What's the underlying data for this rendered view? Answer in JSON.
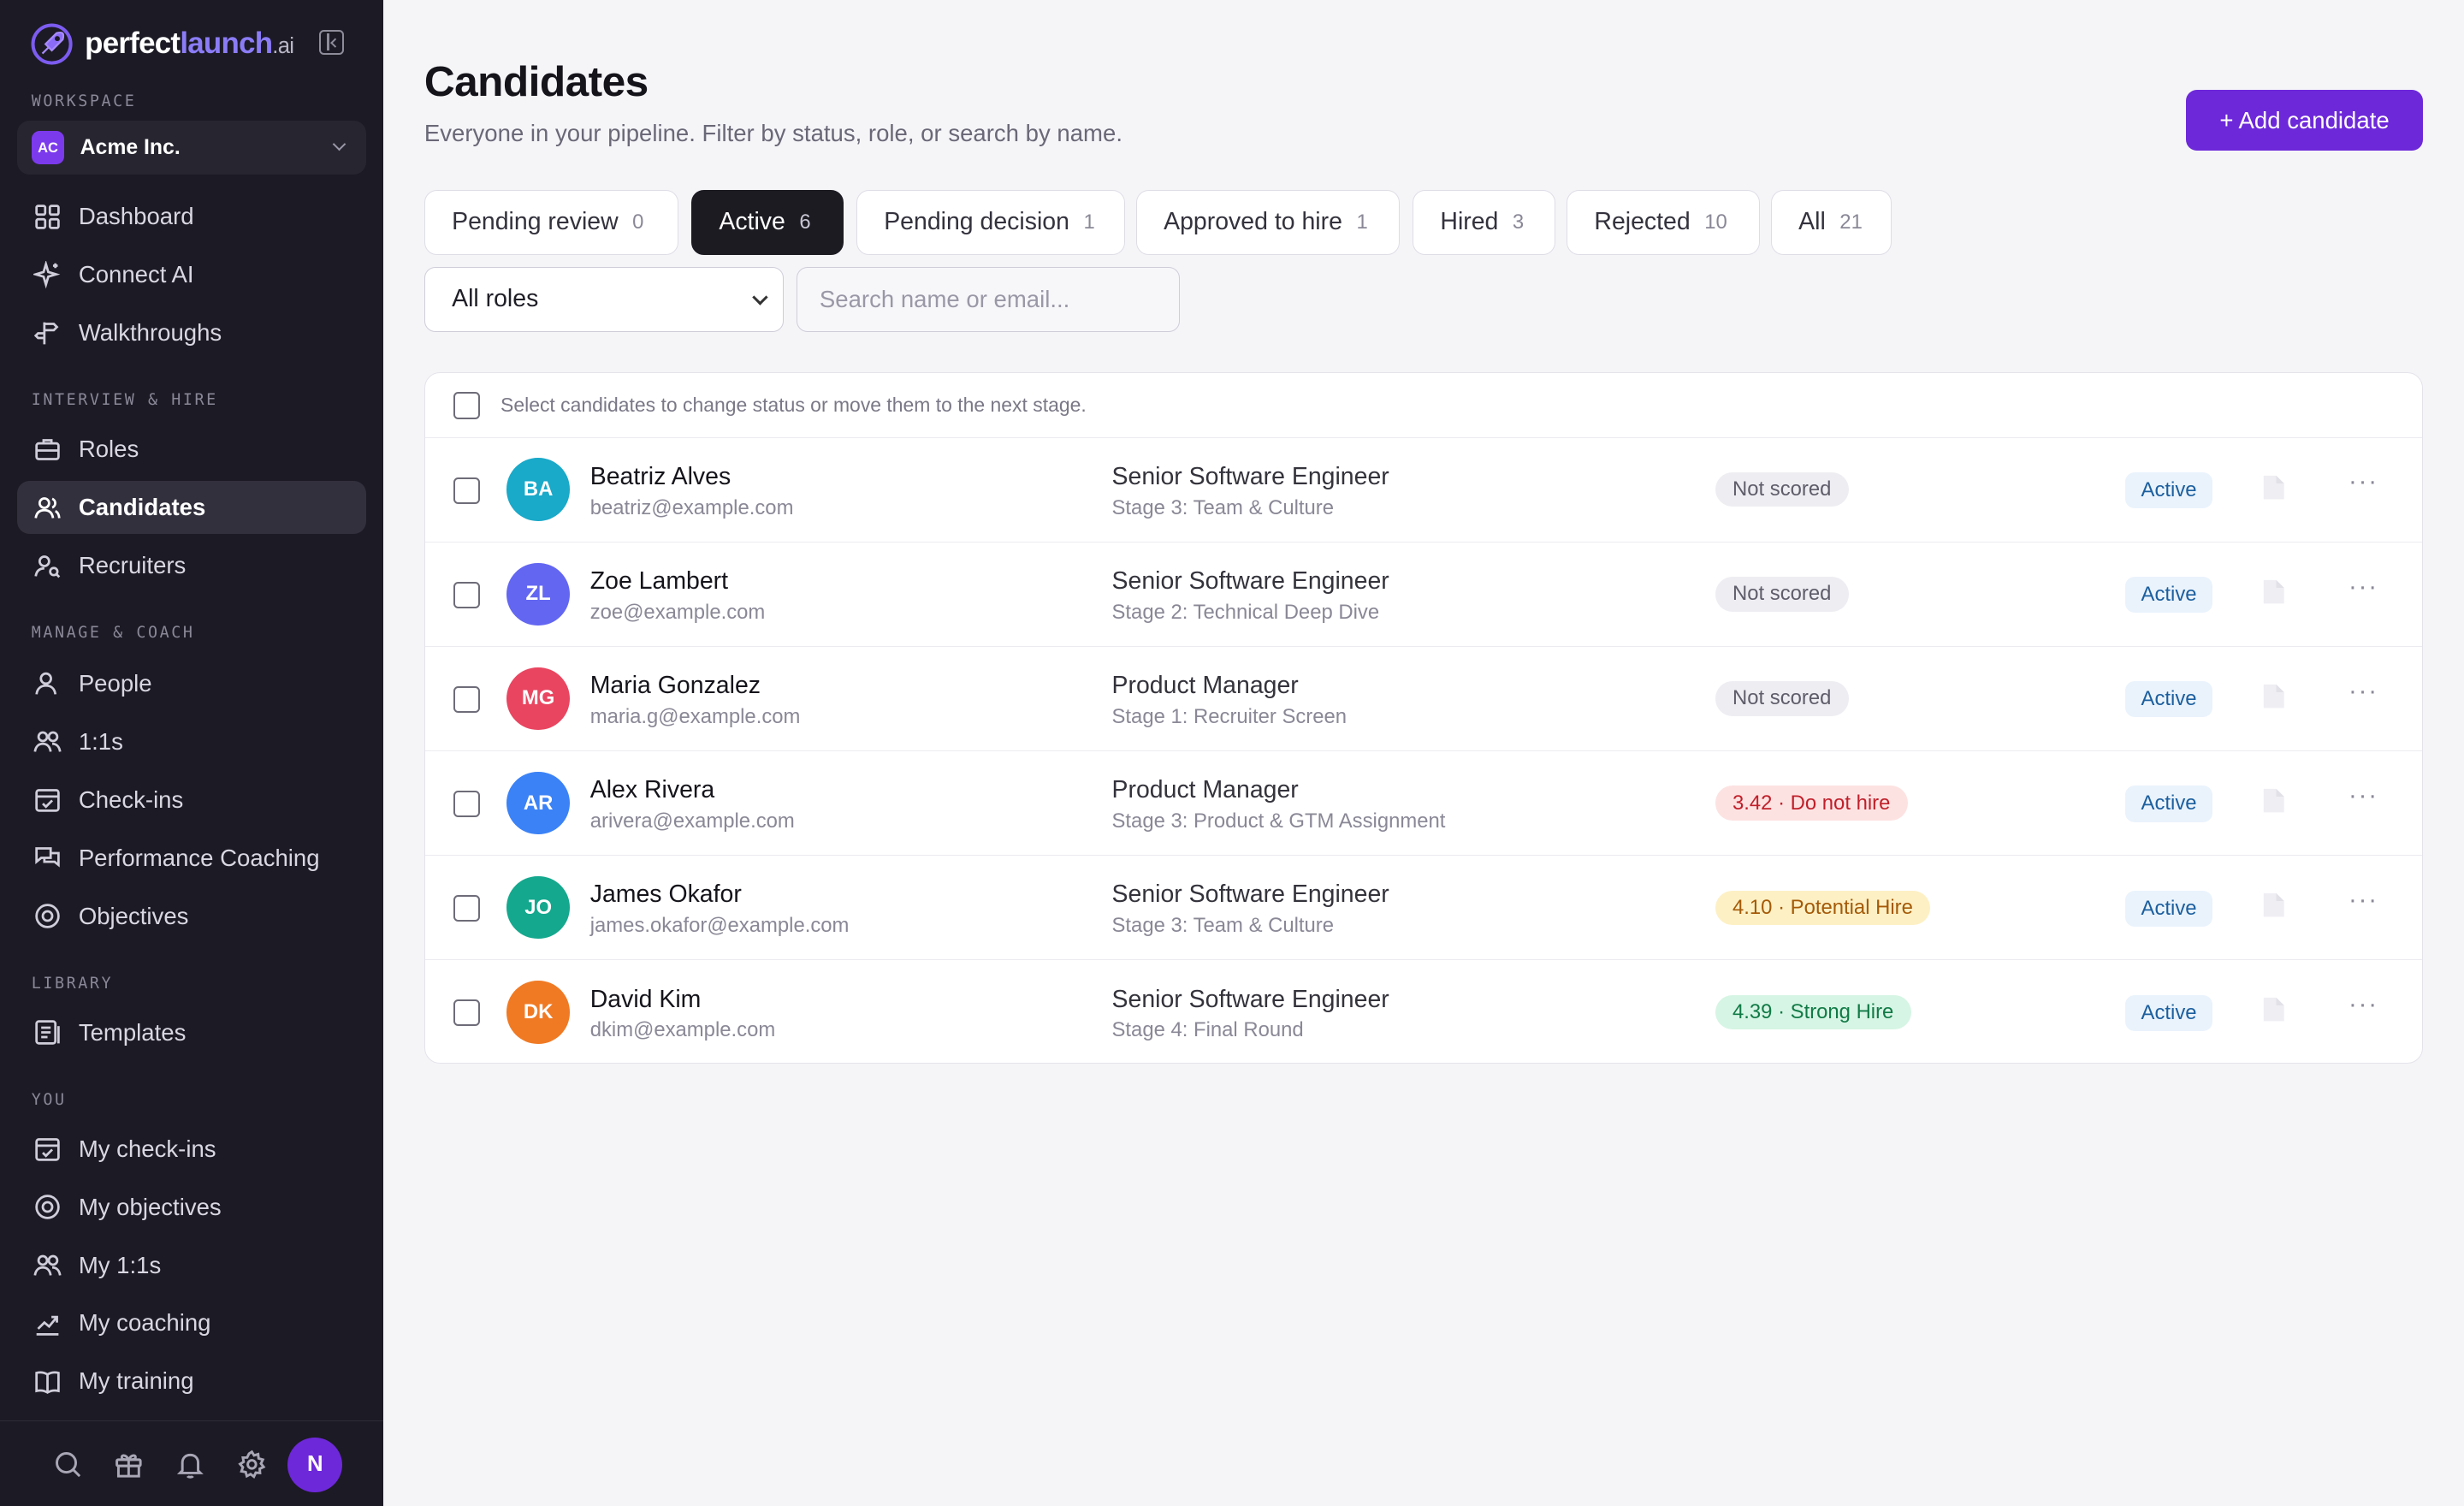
{
  "brand": {
    "name_white": "perfect",
    "name_purple": "launch",
    "suffix": ".ai"
  },
  "sidebar": {
    "workspace_label": "WORKSPACE",
    "workspace": {
      "initials": "AC",
      "name": "Acme Inc."
    },
    "items_top": [
      {
        "label": "Dashboard",
        "icon": "dashboard-icon"
      },
      {
        "label": "Connect AI",
        "icon": "sparkle-icon"
      },
      {
        "label": "Walkthroughs",
        "icon": "signpost-icon"
      }
    ],
    "interview_label": "INTERVIEW & HIRE",
    "items_interview": [
      {
        "label": "Roles",
        "icon": "briefcase-icon"
      },
      {
        "label": "Candidates",
        "icon": "users-icon",
        "active": true
      },
      {
        "label": "Recruiters",
        "icon": "user-search-icon"
      }
    ],
    "manage_label": "MANAGE & COACH",
    "items_manage": [
      {
        "label": "People",
        "icon": "user-icon"
      },
      {
        "label": "1:1s",
        "icon": "users-icon"
      },
      {
        "label": "Check-ins",
        "icon": "calendar-check-icon"
      },
      {
        "label": "Performance Coaching",
        "icon": "chat-icon"
      },
      {
        "label": "Objectives",
        "icon": "target-icon"
      }
    ],
    "library_label": "LIBRARY",
    "items_library": [
      {
        "label": "Templates",
        "icon": "template-icon"
      }
    ],
    "you_label": "YOU",
    "items_you": [
      {
        "label": "My check-ins",
        "icon": "calendar-check-icon"
      },
      {
        "label": "My objectives",
        "icon": "target-icon"
      },
      {
        "label": "My 1:1s",
        "icon": "users-icon"
      },
      {
        "label": "My coaching",
        "icon": "trend-icon"
      },
      {
        "label": "My training",
        "icon": "book-icon"
      }
    ],
    "user_initial": "N"
  },
  "header": {
    "title": "Candidates",
    "subtitle": "Everyone in your pipeline. Filter by status, role, or search by name.",
    "add_button": "+ Add candidate"
  },
  "tabs": [
    {
      "label": "Pending review",
      "count": "0"
    },
    {
      "label": "Active",
      "count": "6",
      "active": true
    },
    {
      "label": "Pending decision",
      "count": "1"
    },
    {
      "label": "Approved to hire",
      "count": "1"
    },
    {
      "label": "Hired",
      "count": "3"
    },
    {
      "label": "Rejected",
      "count": "10"
    },
    {
      "label": "All",
      "count": "21"
    }
  ],
  "filters": {
    "role_value": "All roles",
    "search_placeholder": "Search name or email..."
  },
  "table": {
    "hint": "Select candidates to change status or move them to the next stage.",
    "rows": [
      {
        "initials": "BA",
        "color": "#19a9c9",
        "name": "Beatriz Alves",
        "email": "beatriz@example.com",
        "role": "Senior Software Engineer",
        "stage": "Stage 3: Team & Culture",
        "score": "Not scored",
        "score_kind": "ns",
        "status": "Active"
      },
      {
        "initials": "ZL",
        "color": "#6366f1",
        "name": "Zoe Lambert",
        "email": "zoe@example.com",
        "role": "Senior Software Engineer",
        "stage": "Stage 2: Technical Deep Dive",
        "score": "Not scored",
        "score_kind": "ns",
        "status": "Active"
      },
      {
        "initials": "MG",
        "color": "#e94560",
        "name": "Maria Gonzalez",
        "email": "maria.g@example.com",
        "role": "Product Manager",
        "stage": "Stage 1: Recruiter Screen",
        "score": "Not scored",
        "score_kind": "ns",
        "status": "Active"
      },
      {
        "initials": "AR",
        "color": "#3b82f6",
        "name": "Alex Rivera",
        "email": "arivera@example.com",
        "role": "Product Manager",
        "stage": "Stage 3: Product & GTM Assignment",
        "score": "3.42 · Do not hire",
        "score_kind": "red",
        "status": "Active"
      },
      {
        "initials": "JO",
        "color": "#14a88e",
        "name": "James Okafor",
        "email": "james.okafor@example.com",
        "role": "Senior Software Engineer",
        "stage": "Stage 3: Team & Culture",
        "score": "4.10 · Potential Hire",
        "score_kind": "yellow",
        "status": "Active"
      },
      {
        "initials": "DK",
        "color": "#f07a24",
        "name": "David Kim",
        "email": "dkim@example.com",
        "role": "Senior Software Engineer",
        "stage": "Stage 4: Final Round",
        "score": "4.39 · Strong Hire",
        "score_kind": "green",
        "status": "Active"
      }
    ]
  }
}
